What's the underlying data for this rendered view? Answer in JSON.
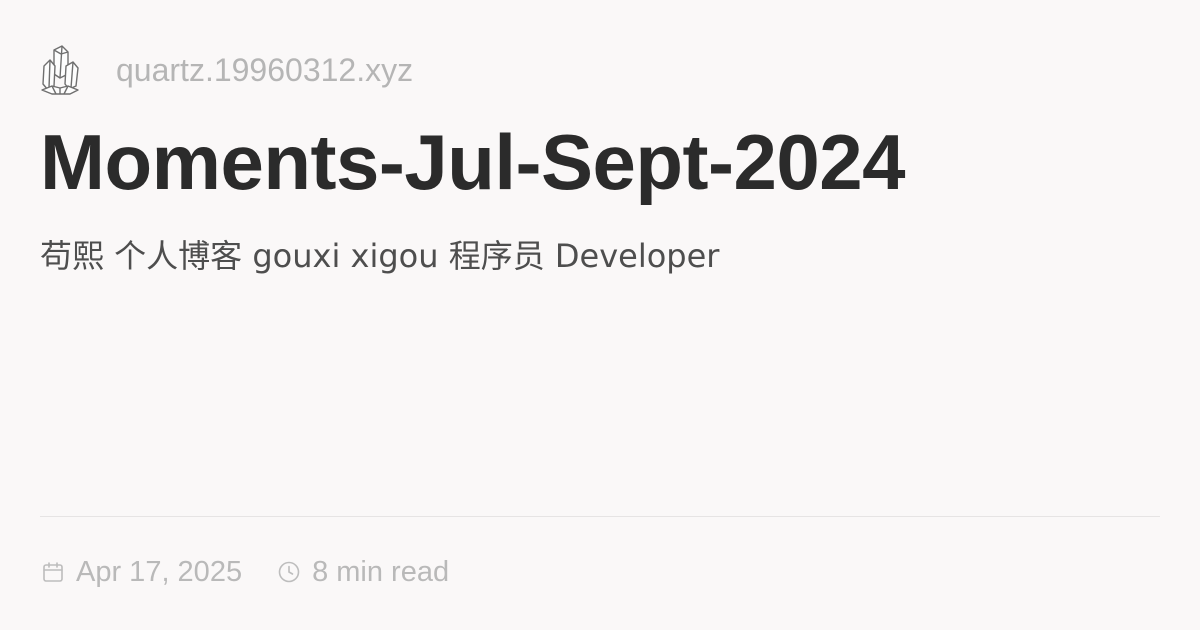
{
  "site": {
    "logo_icon": "crystal-quartz-icon",
    "name": "quartz.19960312.xyz"
  },
  "page": {
    "title": "Moments-Jul-Sept-2024",
    "description": "苟熙 个人博客 gouxi xigou 程序员 Developer"
  },
  "meta": {
    "date_icon": "calendar-icon",
    "date": "Apr 17, 2025",
    "reading_time_icon": "clock-icon",
    "reading_time": "8 min read"
  },
  "colors": {
    "background": "#faf8f8",
    "title": "#2b2b2b",
    "description": "#4e4e4e",
    "muted": "#b9b9b9",
    "divider": "#e6e4e4"
  }
}
